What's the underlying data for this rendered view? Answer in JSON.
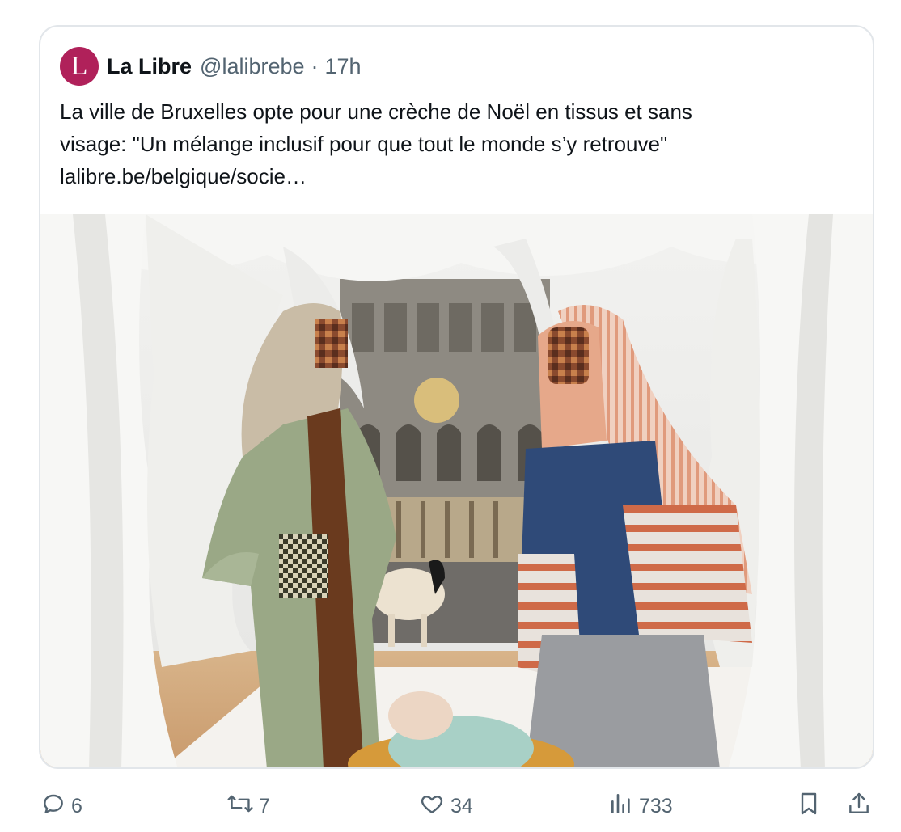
{
  "tweet": {
    "display_name": "La Libre",
    "handle": "@lalibrebe",
    "separator": "·",
    "time": "17h",
    "avatar_letter": "L",
    "text_line_1": "La ville de Bruxelles opte pour une crèche de Noël en tissus et sans",
    "text_line_2": "visage: \"Un mélange inclusif pour que tout le monde s’y retrouve\"",
    "link": "lalibre.be/belgique/socie…"
  },
  "actions": {
    "replies": "6",
    "reposts": "7",
    "likes": "34",
    "views": "733"
  },
  "colors": {
    "avatar_bg": "#b0215a",
    "text": "#0f1419",
    "secondary": "#536471",
    "border": "#e2e6ea"
  },
  "icons": [
    "reply-icon",
    "repost-icon",
    "like-icon",
    "views-icon",
    "bookmark-icon",
    "share-icon"
  ]
}
